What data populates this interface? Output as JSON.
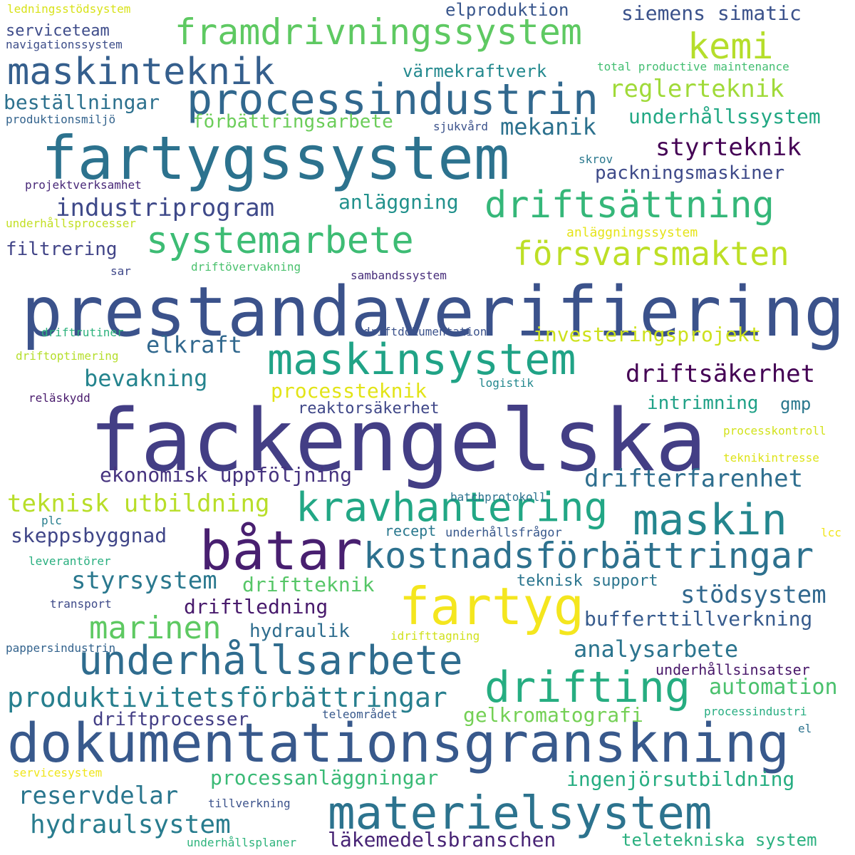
{
  "words": [
    {
      "text": "prestandaverifiering",
      "color": "#3b528b"
    },
    {
      "text": "fackengelska",
      "color": "#433e85"
    },
    {
      "text": "fartygssystem",
      "color": "#2c728e"
    },
    {
      "text": "dokumentationsgranskning",
      "color": "#38598c"
    },
    {
      "text": "båtar",
      "color": "#481f70"
    },
    {
      "text": "fartyg",
      "color": "#f4e61e"
    },
    {
      "text": "materielsystem",
      "color": "#2c738e"
    },
    {
      "text": "processindustrin",
      "color": "#31688e"
    },
    {
      "text": "maskinsystem",
      "color": "#20a386"
    },
    {
      "text": "kravhantering",
      "color": "#22a785"
    },
    {
      "text": "drifting",
      "color": "#26ad81"
    },
    {
      "text": "underhållsarbete",
      "color": "#2f6c8e"
    },
    {
      "text": "kostnadsförbättringar",
      "color": "#2d718e"
    },
    {
      "text": "maskin",
      "color": "#24868e"
    },
    {
      "text": "framdrivningssystem",
      "color": "#5ec962"
    },
    {
      "text": "maskinteknik",
      "color": "#355f8d"
    },
    {
      "text": "systemarbete",
      "color": "#3dbc74"
    },
    {
      "text": "driftsättning",
      "color": "#35b779"
    },
    {
      "text": "kemi",
      "color": "#b5de2b"
    },
    {
      "text": "försvarsmakten",
      "color": "#bddf26"
    },
    {
      "text": "marinen",
      "color": "#5ec962"
    },
    {
      "text": "produktivitetsförbättringar",
      "color": "#277f8e"
    },
    {
      "text": "hydraulsystem",
      "color": "#287c8e"
    },
    {
      "text": "industriprogram",
      "color": "#3e4989"
    },
    {
      "text": "styrsystem",
      "color": "#2a788e"
    },
    {
      "text": "reservdelar",
      "color": "#2a768e"
    },
    {
      "text": "läkemedelsbranschen",
      "color": "#482475"
    },
    {
      "text": "teknisk utbildning",
      "color": "#b8de29"
    },
    {
      "text": "driftsäkerhet",
      "color": "#440154"
    },
    {
      "text": "drifterfarenhet",
      "color": "#2e6e8e"
    },
    {
      "text": "stödsystem",
      "color": "#31688e"
    },
    {
      "text": "skeppsbyggnad",
      "color": "#404688"
    },
    {
      "text": "ekonomisk uppföljning",
      "color": "#46337f"
    },
    {
      "text": "styrteknik",
      "color": "#440154"
    },
    {
      "text": "reglerteknik",
      "color": "#a0da39"
    },
    {
      "text": "mekanik",
      "color": "#2c718e"
    },
    {
      "text": "elkraft",
      "color": "#31688e"
    },
    {
      "text": "bevakning",
      "color": "#25848e"
    },
    {
      "text": "analysarbete",
      "color": "#2b748e"
    },
    {
      "text": "automation",
      "color": "#4ac16d"
    },
    {
      "text": "investeringsprojekt",
      "color": "#cde11d"
    },
    {
      "text": "processteknik",
      "color": "#e2e418"
    },
    {
      "text": "beställningar",
      "color": "#2d718e"
    },
    {
      "text": "underhållssystem",
      "color": "#22a884"
    },
    {
      "text": "packningsmaskiner",
      "color": "#3e4a89"
    },
    {
      "text": "förbättringsarbete",
      "color": "#6ccd5a"
    },
    {
      "text": "anläggning",
      "color": "#21918c"
    },
    {
      "text": "siemens simatic",
      "color": "#3b528b"
    },
    {
      "text": "elproduktion",
      "color": "#39568c"
    },
    {
      "text": "värmekraftverk",
      "color": "#23898e"
    },
    {
      "text": "filtrering",
      "color": "#414487"
    },
    {
      "text": "serviceteam",
      "color": "#3e4c8a"
    },
    {
      "text": "driftteknik",
      "color": "#56c667"
    },
    {
      "text": "driftledning",
      "color": "#481a6c"
    },
    {
      "text": "hydraulik",
      "color": "#2e6d8e"
    },
    {
      "text": "bufferttillverkning",
      "color": "#375b8d"
    },
    {
      "text": "gelkromatografi",
      "color": "#74d055"
    },
    {
      "text": "processanläggningar",
      "color": "#3aba76"
    },
    {
      "text": "ingenjörsutbildning",
      "color": "#26ad81"
    },
    {
      "text": "teletekniska system",
      "color": "#2ab07f"
    },
    {
      "text": "driftprocesser",
      "color": "#433e85"
    },
    {
      "text": "intrimning",
      "color": "#1fa187"
    },
    {
      "text": "gmp",
      "color": "#2a788e"
    },
    {
      "text": "reaktorsäkerhet",
      "color": "#3f4788"
    },
    {
      "text": "teknisk support",
      "color": "#2b758e"
    },
    {
      "text": "underhållsinsatser",
      "color": "#481769"
    },
    {
      "text": "recept",
      "color": "#2a788e"
    },
    {
      "text": "underhållsfrågor",
      "color": "#38588c"
    },
    {
      "text": "batchprotokoll",
      "color": "#2c728e"
    },
    {
      "text": "logistik",
      "color": "#23888e"
    },
    {
      "text": "total productive maintenance",
      "color": "#42be71"
    },
    {
      "text": "ledningsstödsystem",
      "color": "#d8e219"
    },
    {
      "text": "navigationssystem",
      "color": "#3d4e8a"
    },
    {
      "text": "produktionsmiljö",
      "color": "#33638d"
    },
    {
      "text": "sjukvård",
      "color": "#3b528b"
    },
    {
      "text": "skrov",
      "color": "#2a788e"
    },
    {
      "text": "projektverksamhet",
      "color": "#482878"
    },
    {
      "text": "underhållsprocesser",
      "color": "#c2df23"
    },
    {
      "text": "anläggningssystem",
      "color": "#e5e419"
    },
    {
      "text": "driftövervakning",
      "color": "#4ac16d"
    },
    {
      "text": "sambandssystem",
      "color": "#472d7b"
    },
    {
      "text": "sar",
      "color": "#3f4889"
    },
    {
      "text": "driftrutiner",
      "color": "#2db27d"
    },
    {
      "text": "driftdokumentation",
      "color": "#3b528b"
    },
    {
      "text": "driftoptimering",
      "color": "#b5de2b"
    },
    {
      "text": "reläskydd",
      "color": "#481a6c"
    },
    {
      "text": "processkontroll",
      "color": "#d2e21b"
    },
    {
      "text": "teknikintresse",
      "color": "#dde318"
    },
    {
      "text": "plc",
      "color": "#277e8e"
    },
    {
      "text": "lcc",
      "color": "#f1e51d"
    },
    {
      "text": "leverantörer",
      "color": "#29af7f"
    },
    {
      "text": "transport",
      "color": "#3e4a89"
    },
    {
      "text": "idrifttagning",
      "color": "#d0e11c"
    },
    {
      "text": "pappersindustrin",
      "color": "#33638d"
    },
    {
      "text": "teleområdet",
      "color": "#38598c"
    },
    {
      "text": "processindustri",
      "color": "#27ad81"
    },
    {
      "text": "el",
      "color": "#2c728e"
    },
    {
      "text": "servicesystem",
      "color": "#efe51c"
    },
    {
      "text": "tillverkning",
      "color": "#3b528b"
    },
    {
      "text": "underhållsplaner",
      "color": "#2eb37c"
    }
  ]
}
